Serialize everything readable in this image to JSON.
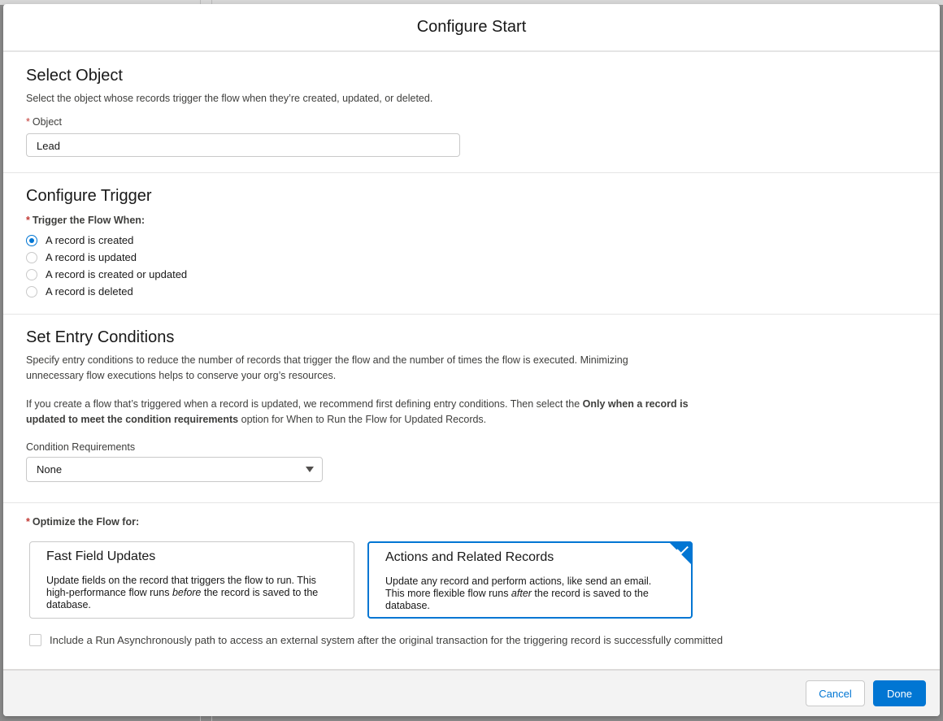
{
  "modal": {
    "title": "Configure Start"
  },
  "select_object": {
    "title": "Select Object",
    "help": "Select the object whose records trigger the flow when they’re created, updated, or deleted.",
    "field_label": "Object",
    "field_value": "Lead"
  },
  "configure_trigger": {
    "title": "Configure Trigger",
    "field_label": "Trigger the Flow When:",
    "options": [
      {
        "label": "A record is created",
        "checked": true
      },
      {
        "label": "A record is updated",
        "checked": false
      },
      {
        "label": "A record is created or updated",
        "checked": false
      },
      {
        "label": "A record is deleted",
        "checked": false
      }
    ]
  },
  "entry_conditions": {
    "title": "Set Entry Conditions",
    "help1": "Specify entry conditions to reduce the number of records that trigger the flow and the number of times the flow is executed. Minimizing unnecessary flow executions helps to conserve your org’s resources.",
    "help2_a": "If you create a flow that’s triggered when a record is updated, we recommend first defining entry conditions. Then select the ",
    "help2_bold": "Only when a record is updated to meet the condition requirements",
    "help2_b": " option for When to Run the Flow for Updated Records.",
    "condition_label": "Condition Requirements",
    "condition_value": "None"
  },
  "optimize": {
    "label": "Optimize the Flow for:",
    "cards": [
      {
        "title": "Fast Field Updates",
        "desc_a": "Update fields on the record that triggers the flow to run. This high-performance flow runs ",
        "desc_em": "before",
        "desc_b": " the record is saved to the database.",
        "selected": false
      },
      {
        "title": "Actions and Related Records",
        "desc_a": "Update any record and perform actions, like send an email. This more flexible flow runs ",
        "desc_em": "after",
        "desc_b": " the record is saved to the database.",
        "selected": true
      }
    ],
    "async_label": "Include a Run Asynchronously path to access an external system after the original transaction for the triggering record is successfully committed",
    "async_checked": false
  },
  "footer": {
    "cancel": "Cancel",
    "done": "Done"
  },
  "required_marker": "*",
  "colors": {
    "brand": "#0176d3",
    "required": "#c23934"
  }
}
